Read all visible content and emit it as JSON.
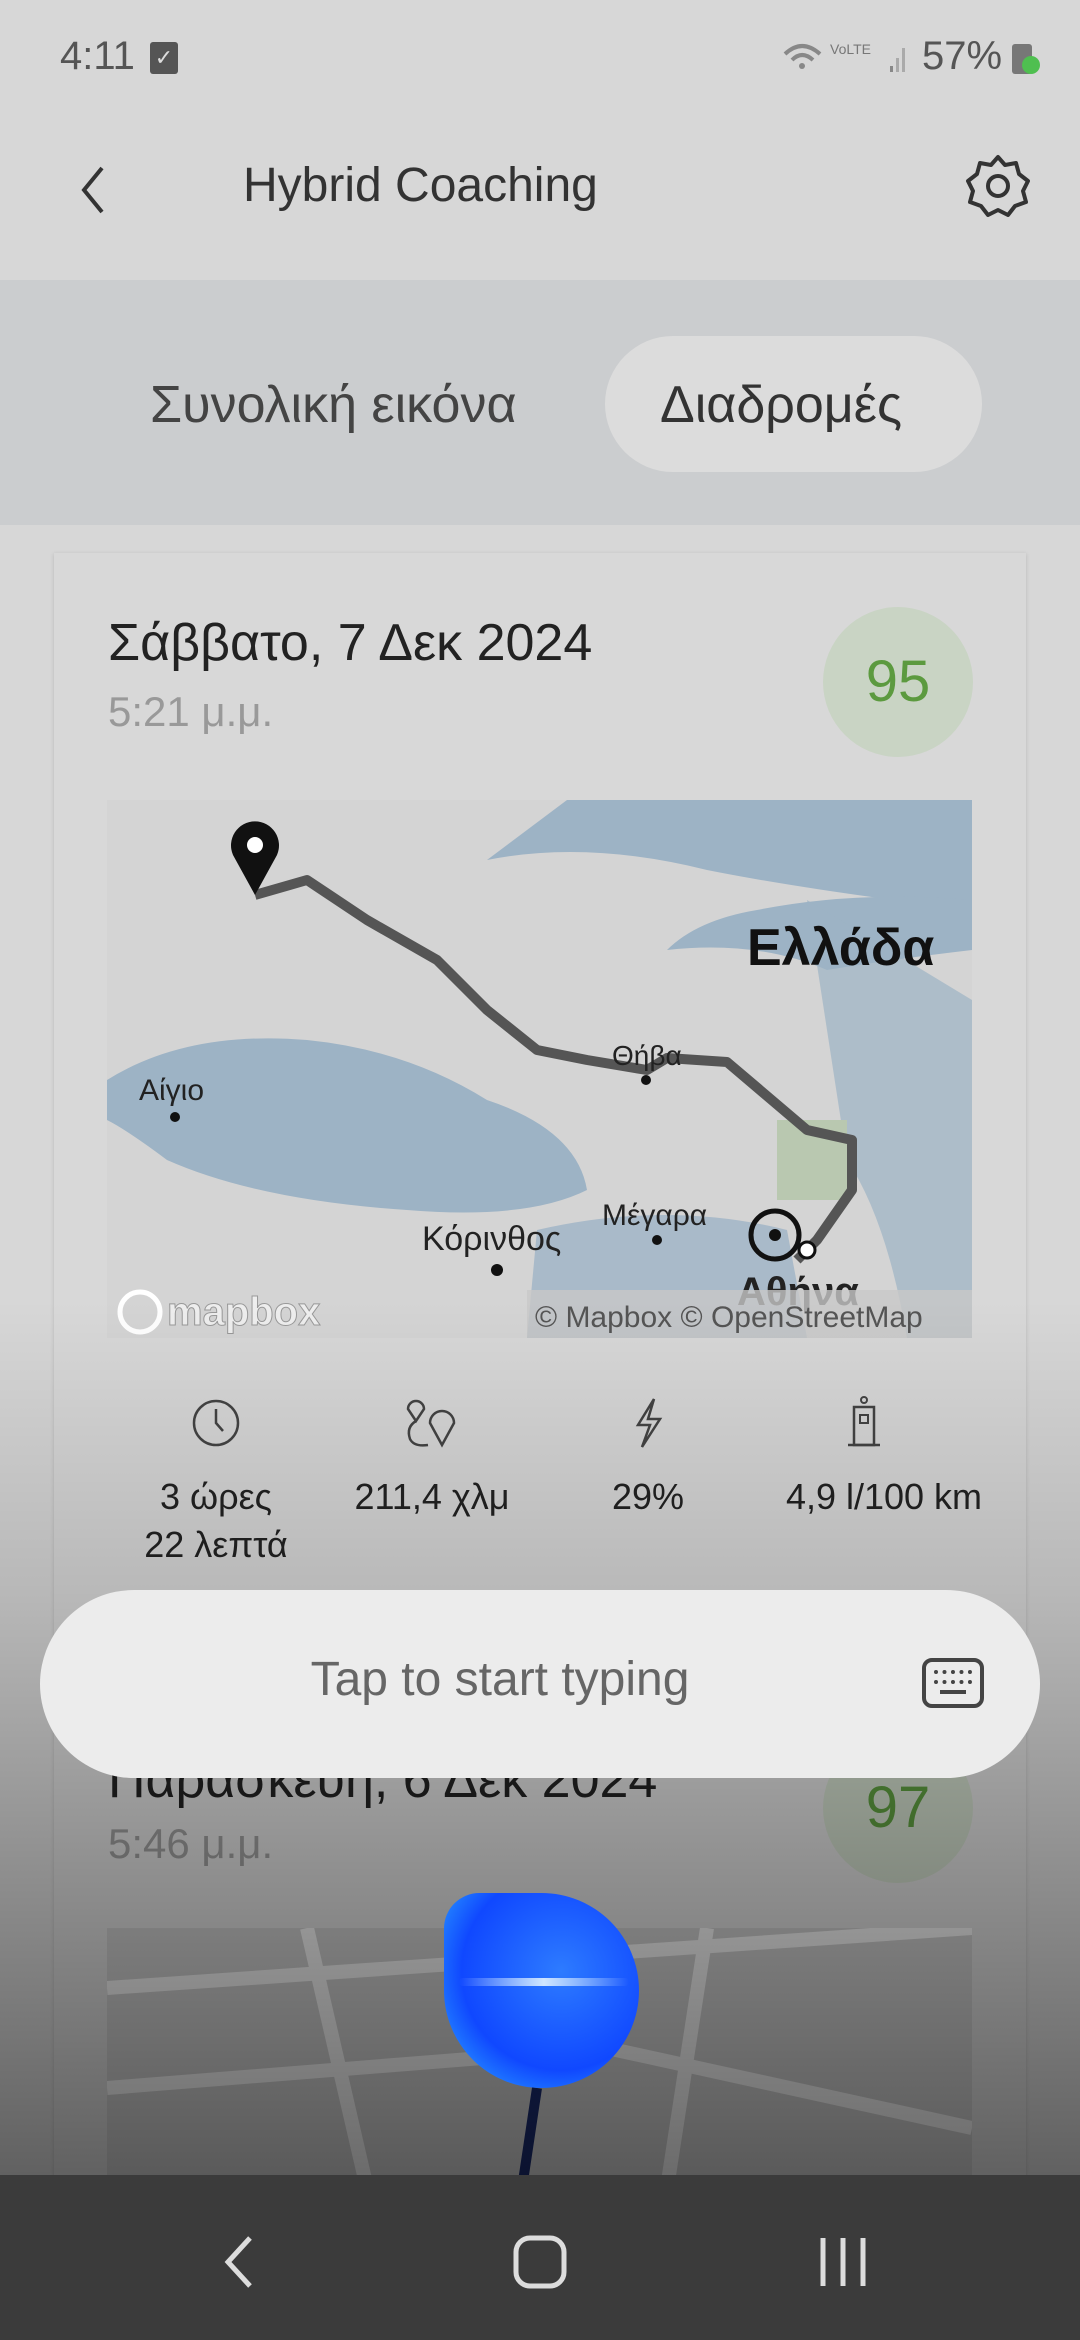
{
  "status_bar": {
    "time": "4:11",
    "battery": "57%",
    "network": "VoLTE"
  },
  "header": {
    "title": "Hybrid Coaching",
    "back_icon": "chevron-left-icon",
    "settings_icon": "gear-icon"
  },
  "tabs": [
    {
      "label": "Συνολική εικόνα",
      "selected": false
    },
    {
      "label": "Διαδρομές",
      "selected": true
    }
  ],
  "trips": [
    {
      "date": "Σάββατο, 7 Δεκ 2024",
      "time": "5:21 μ.μ.",
      "score": "95",
      "map": {
        "labels": [
          "Ελλάδα",
          "Θήβα",
          "Αίγιο",
          "Κόρινθος",
          "Μέγαρα",
          "Αθήνα"
        ],
        "logo": "mapbox",
        "attribution": "© Mapbox © OpenStreetMap"
      },
      "stats": [
        {
          "icon": "clock-icon",
          "line1": "3 ώρες",
          "line2": "22 λεπτά"
        },
        {
          "icon": "route-icon",
          "line1": "211,4 χλμ"
        },
        {
          "icon": "lightning-icon",
          "line1": "29%"
        },
        {
          "icon": "fuel-pump-icon",
          "line1": "4,9 l/100 km"
        }
      ]
    },
    {
      "date": "Παρασκευή, 6 Δεκ 2024",
      "time": "5:46 μ.μ.",
      "score": "97"
    }
  ],
  "voice_input": {
    "placeholder": "Tap to start typing",
    "keyboard_icon": "keyboard-icon"
  },
  "colors": {
    "score_green": "#5c9a3f",
    "route": "#555555",
    "assistant_blue": "#1048ff"
  }
}
